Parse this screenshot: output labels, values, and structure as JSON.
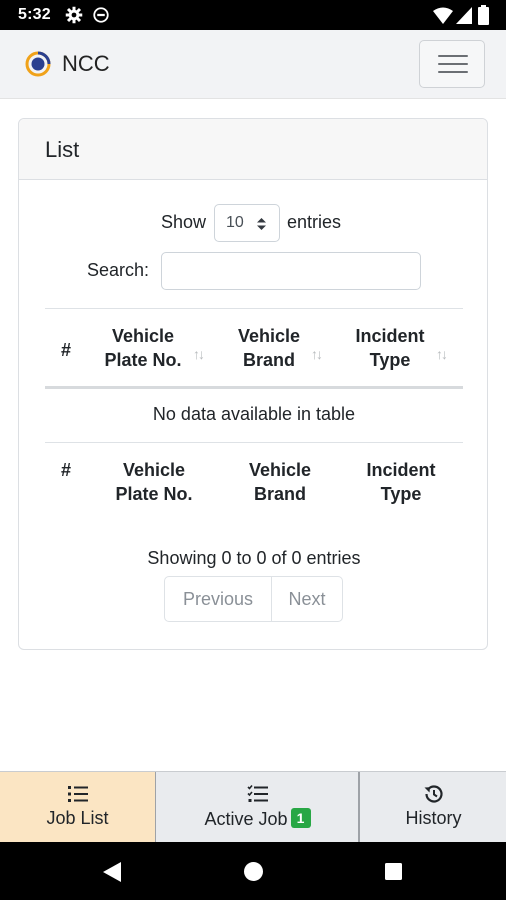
{
  "status_bar": {
    "time": "5:32",
    "left_icons": [
      "gear-icon",
      "screen-cast-icon"
    ],
    "right_icons": [
      "wifi-icon",
      "cell-signal-icon",
      "battery-icon"
    ]
  },
  "header": {
    "brand": "NCC",
    "logo_icon": "ncc-logo-icon",
    "menu_icon": "hamburger-menu-icon"
  },
  "card": {
    "title": "List",
    "length": {
      "show_label": "Show",
      "selected": "10",
      "entries_label": "entries"
    },
    "search": {
      "label": "Search:",
      "value": "",
      "placeholder": ""
    },
    "table": {
      "columns": [
        {
          "line1": "#",
          "line2": ""
        },
        {
          "line1": "Vehicle",
          "line2": "Plate No."
        },
        {
          "line1": "Vehicle",
          "line2": "Brand"
        },
        {
          "line1": "Incident",
          "line2": "Type"
        }
      ],
      "empty_message": "No data available in table"
    },
    "info": "Showing 0 to 0 of 0 entries",
    "pagination": {
      "previous": "Previous",
      "next": "Next"
    }
  },
  "bottom_tabs": [
    {
      "label": "Job List",
      "icon": "list-icon",
      "active": true,
      "badge": ""
    },
    {
      "label": "Active Job",
      "icon": "checklist-icon",
      "active": false,
      "badge": "1"
    },
    {
      "label": "History",
      "icon": "history-icon",
      "active": false,
      "badge": ""
    }
  ],
  "system_nav": {
    "icons": [
      "back-icon",
      "home-icon",
      "recents-icon"
    ]
  },
  "colors": {
    "active_tab_bg": "#fbe5c3",
    "badge_bg": "#28a745",
    "header_bg": "#f2f3f5"
  }
}
